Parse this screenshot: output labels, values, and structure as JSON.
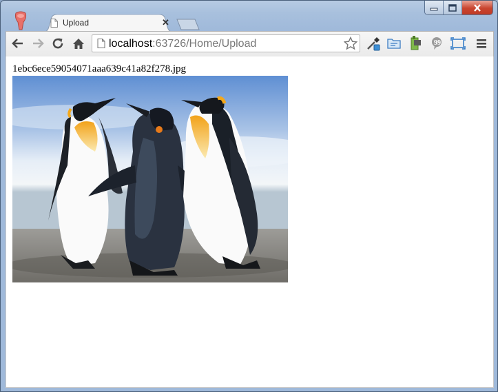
{
  "window": {
    "caption_buttons": {
      "minimize": "minimize",
      "maximize": "maximize",
      "close": "close"
    }
  },
  "tabs": [
    {
      "title": "Upload",
      "active": true,
      "icon": "page-icon"
    }
  ],
  "toolbar": {
    "back_icon": "back-arrow-icon",
    "forward_icon": "forward-arrow-icon",
    "reload_icon": "reload-icon",
    "home_icon": "home-icon",
    "omnibox": {
      "host": "localhost",
      "port_path": ":63726/Home/Upload"
    },
    "extensions": [
      "eyedropper-icon",
      "folder-icon",
      "evernote-icon",
      "quote-icon",
      "fullscreen-icon"
    ],
    "menu_icon": "hamburger-menu-icon"
  },
  "page": {
    "filename": "1ebc6ece59054071aaa639c41a82f278.jpg",
    "image": "penguins-photo"
  },
  "colors": {
    "chrome_frame": "#a8c0dd",
    "toolbar_bg": "#f1f1f1",
    "close_red": "#c9452f"
  }
}
